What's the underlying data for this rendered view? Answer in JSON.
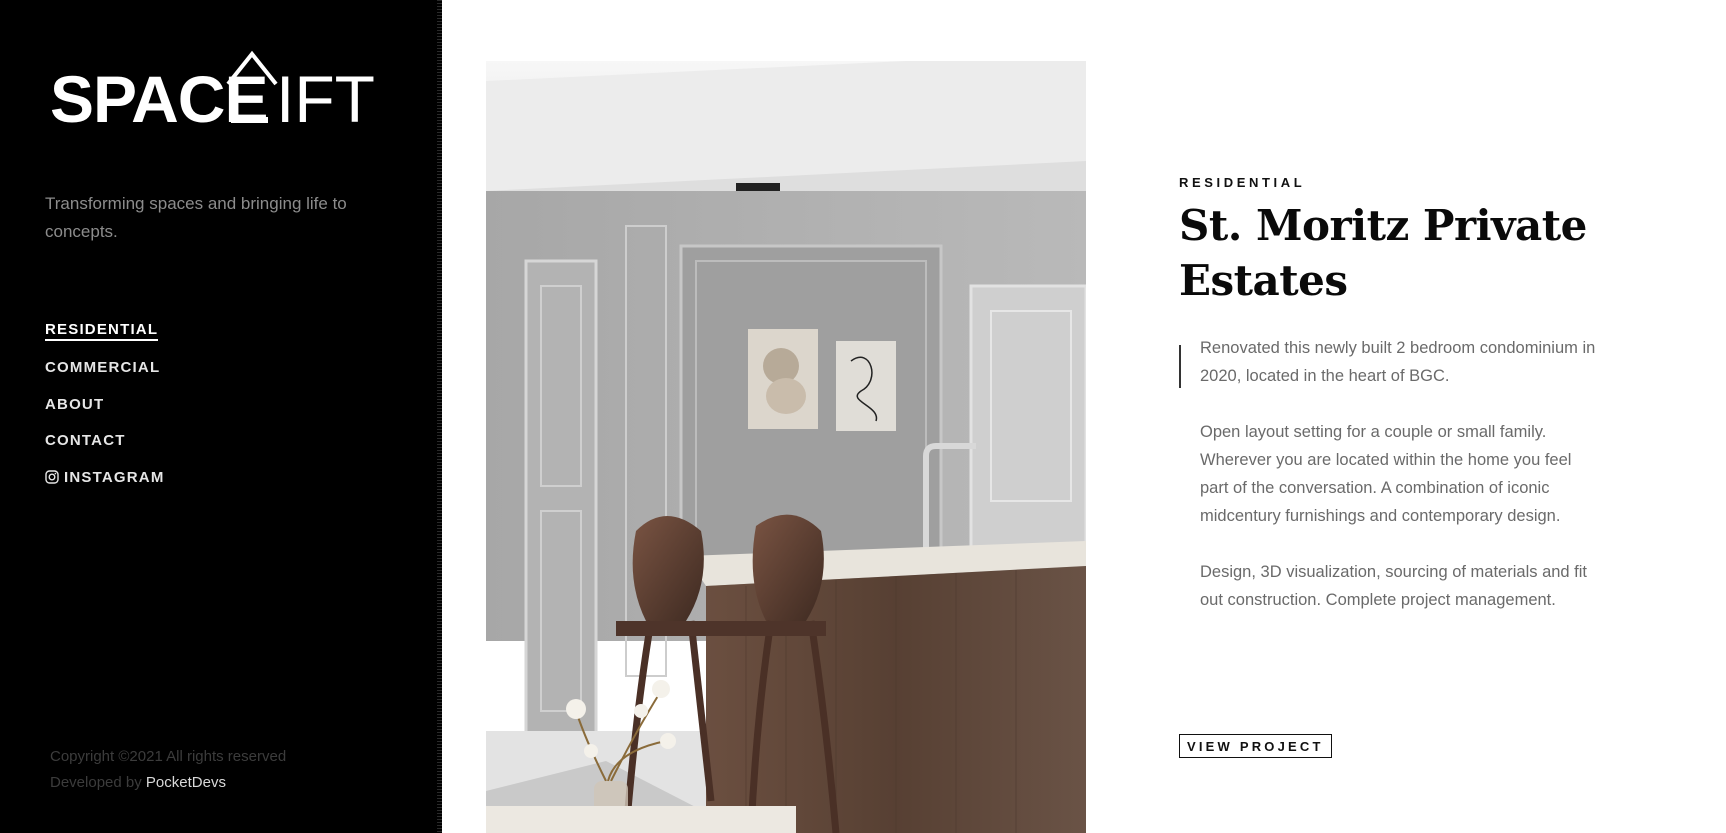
{
  "brand": {
    "logo_text": "SPACELIFT"
  },
  "sidebar": {
    "tagline": "Transforming spaces and bringing life to concepts.",
    "nav": [
      {
        "label": "RESIDENTIAL",
        "active": true
      },
      {
        "label": "COMMERCIAL",
        "active": false
      },
      {
        "label": "ABOUT",
        "active": false
      },
      {
        "label": "CONTACT",
        "active": false
      },
      {
        "label": "INSTAGRAM",
        "active": false,
        "icon": "instagram-icon"
      }
    ],
    "footer": {
      "copyright": "Copyright ©2021 All rights reserved",
      "developed_by": "Developed by",
      "developer": "PocketDevs"
    }
  },
  "project": {
    "category": "RESIDENTIAL",
    "title": "St. Moritz Private Estates",
    "paragraphs": [
      "Renovated this newly built 2 bedroom condominium in 2020, located in the heart of BGC.",
      "Open layout setting for a couple or small family. Wherever you are located within the home you feel part of the conversation. A combination of iconic midcentury furnishings and contemporary design.",
      "Design, 3D visualization, sourcing of materials and fit out construction. Complete project management."
    ],
    "cta_label": "VIEW PROJECT"
  },
  "colors": {
    "sidebar_bg": "#000000",
    "page_bg": "#ffffff",
    "text_muted": "#6a6a6a",
    "wood": "#5a4033"
  }
}
